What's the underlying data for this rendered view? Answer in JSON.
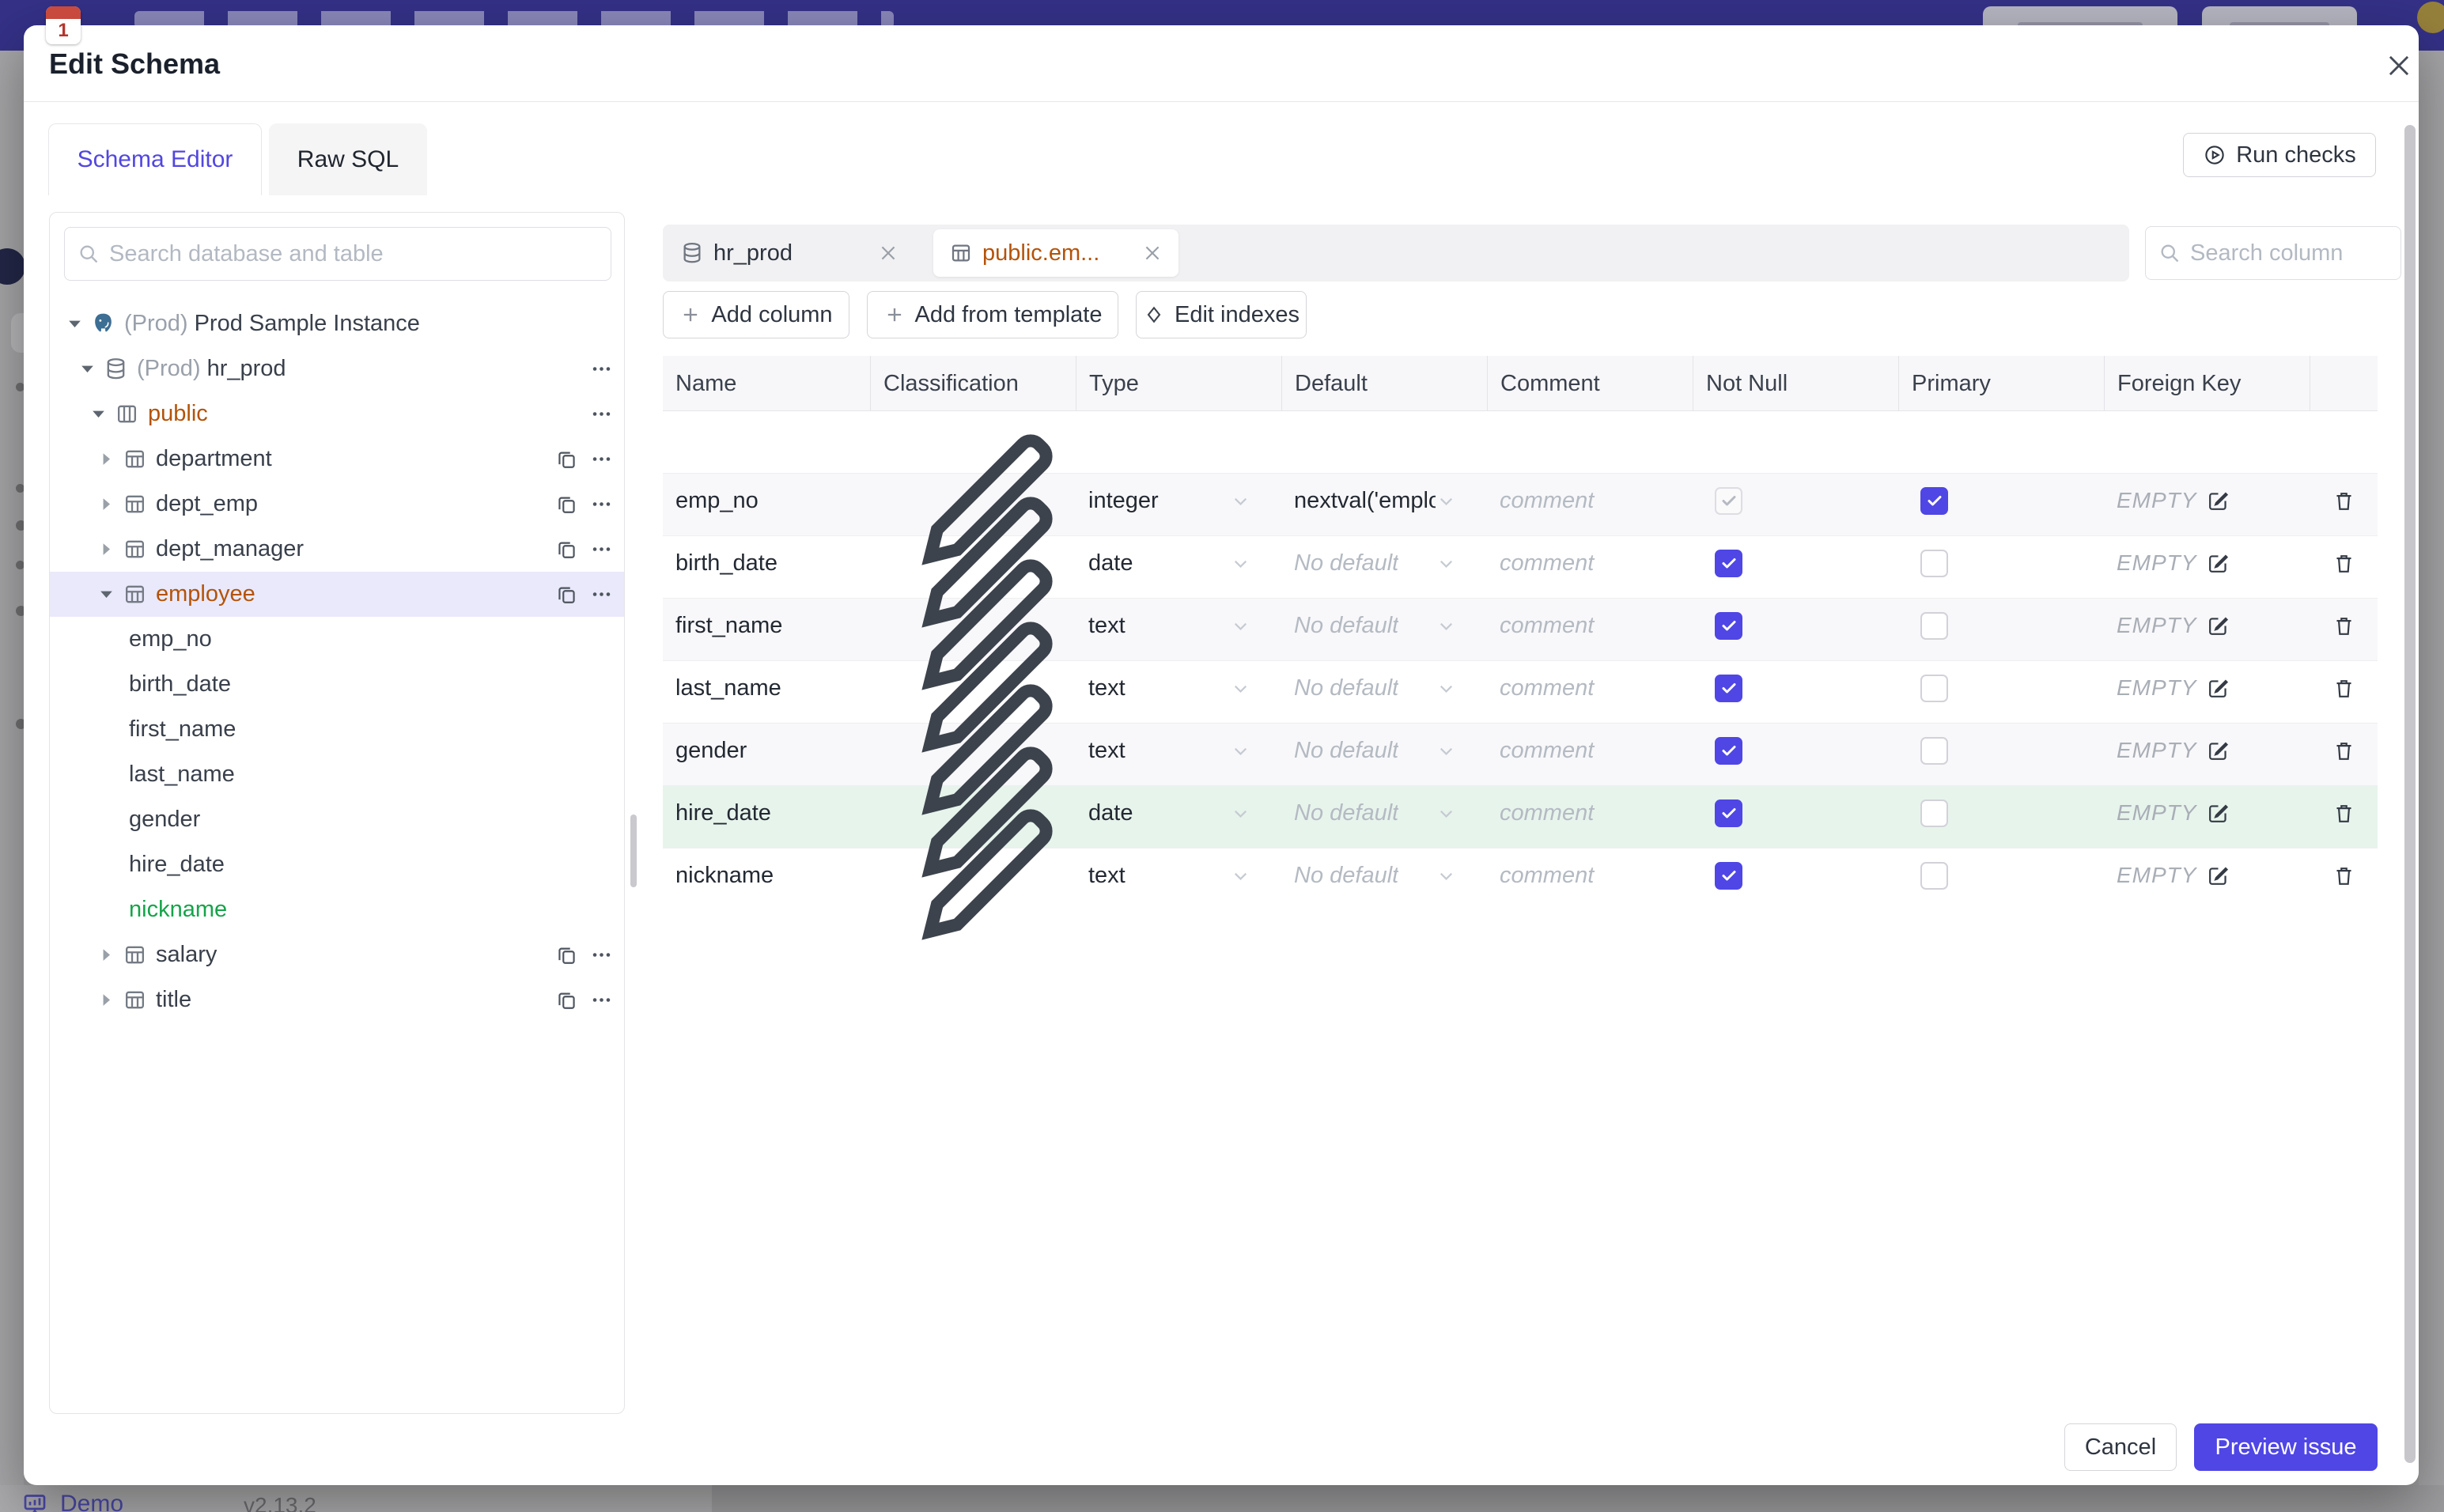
{
  "modal": {
    "title": "Edit Schema",
    "tabs": [
      {
        "label": "Schema Editor",
        "active": true
      },
      {
        "label": "Raw SQL",
        "active": false
      }
    ],
    "run_checks_label": "Run checks",
    "footer": {
      "cancel_label": "Cancel",
      "primary_label": "Preview issue"
    }
  },
  "sidebar": {
    "search_placeholder": "Search database and table",
    "tree": [
      {
        "label": "Prod Sample Instance",
        "prefix": "(Prod)",
        "icon": "postgres-icon",
        "level": 0,
        "chevron": "expanded",
        "actions": []
      },
      {
        "label": "hr_prod",
        "prefix": "(Prod)",
        "icon": "database-icon",
        "level": 1,
        "chevron": "expanded",
        "actions": [
          "more"
        ]
      },
      {
        "label": "public",
        "icon": "schema-icon",
        "level": 2,
        "chevron": "expanded",
        "accent": "amber",
        "actions": [
          "more"
        ]
      },
      {
        "label": "department",
        "icon": "table-icon",
        "level": 3,
        "chevron": "collapsed",
        "actions": [
          "copy",
          "more"
        ]
      },
      {
        "label": "dept_emp",
        "icon": "table-icon",
        "level": 3,
        "chevron": "collapsed",
        "actions": [
          "copy",
          "more"
        ]
      },
      {
        "label": "dept_manager",
        "icon": "table-icon",
        "level": 3,
        "chevron": "collapsed",
        "actions": [
          "copy",
          "more"
        ]
      },
      {
        "label": "employee",
        "icon": "table-icon",
        "level": 3,
        "chevron": "expanded",
        "accent": "amber",
        "selected": true,
        "actions": [
          "copy",
          "more"
        ]
      },
      {
        "label": "emp_no",
        "level": 4,
        "column": true
      },
      {
        "label": "birth_date",
        "level": 4,
        "column": true
      },
      {
        "label": "first_name",
        "level": 4,
        "column": true
      },
      {
        "label": "last_name",
        "level": 4,
        "column": true
      },
      {
        "label": "gender",
        "level": 4,
        "column": true
      },
      {
        "label": "hire_date",
        "level": 4,
        "column": true
      },
      {
        "label": "nickname",
        "level": 4,
        "column": true,
        "accent": "green"
      },
      {
        "label": "salary",
        "icon": "table-icon",
        "level": 3,
        "chevron": "collapsed",
        "actions": [
          "copy",
          "more"
        ]
      },
      {
        "label": "title",
        "icon": "table-icon",
        "level": 3,
        "chevron": "collapsed",
        "actions": [
          "copy",
          "more"
        ]
      }
    ]
  },
  "editor": {
    "tabs": [
      {
        "label": "hr_prod",
        "icon": "database-icon",
        "active": false
      },
      {
        "label": "public.em...",
        "icon": "table-icon",
        "active": true
      }
    ],
    "toolbar": [
      {
        "label": "Add column",
        "icon": "plus-icon"
      },
      {
        "label": "Add from template",
        "icon": "plus-icon"
      },
      {
        "label": "Edit indexes",
        "icon": "diamond-icon"
      }
    ],
    "column_search_placeholder": "Search column",
    "table": {
      "headers": [
        "Name",
        "Classification",
        "Type",
        "Default",
        "Comment",
        "Not Null",
        "Primary",
        "Foreign Key",
        ""
      ],
      "comment_placeholder": "comment",
      "foreign_key_empty_label": "EMPTY",
      "rows": [
        {
          "name": "emp_no",
          "type": "integer",
          "default": "nextval('employ",
          "default_is_placeholder": false,
          "not_null_checked": true,
          "not_null_disabled": true,
          "primary_checked": true,
          "highlight": ""
        },
        {
          "name": "birth_date",
          "type": "date",
          "default": "No default",
          "default_is_placeholder": true,
          "not_null_checked": true,
          "not_null_disabled": false,
          "primary_checked": false,
          "highlight": ""
        },
        {
          "name": "first_name",
          "type": "text",
          "default": "No default",
          "default_is_placeholder": true,
          "not_null_checked": true,
          "not_null_disabled": false,
          "primary_checked": false,
          "highlight": ""
        },
        {
          "name": "last_name",
          "type": "text",
          "default": "No default",
          "default_is_placeholder": true,
          "not_null_checked": true,
          "not_null_disabled": false,
          "primary_checked": false,
          "highlight": ""
        },
        {
          "name": "gender",
          "type": "text",
          "default": "No default",
          "default_is_placeholder": true,
          "not_null_checked": true,
          "not_null_disabled": false,
          "primary_checked": false,
          "highlight": ""
        },
        {
          "name": "hire_date",
          "type": "date",
          "default": "No default",
          "default_is_placeholder": true,
          "not_null_checked": true,
          "not_null_disabled": false,
          "primary_checked": false,
          "highlight": ""
        },
        {
          "name": "nickname",
          "type": "text",
          "default": "No default",
          "default_is_placeholder": true,
          "not_null_checked": true,
          "not_null_disabled": false,
          "primary_checked": false,
          "highlight": "green"
        }
      ]
    }
  },
  "background": {
    "demo_label": "Demo",
    "app_version": "v2.13.2"
  },
  "colors": {
    "accent_indigo": "#4f46e5",
    "selected_table_amber": "#b45309",
    "new_item_green": "#16a34a",
    "selected_row_bg": "#e9e9fb",
    "new_row_bg": "#e7f4ec",
    "topbar_indigo_dimmed": "#343187"
  }
}
